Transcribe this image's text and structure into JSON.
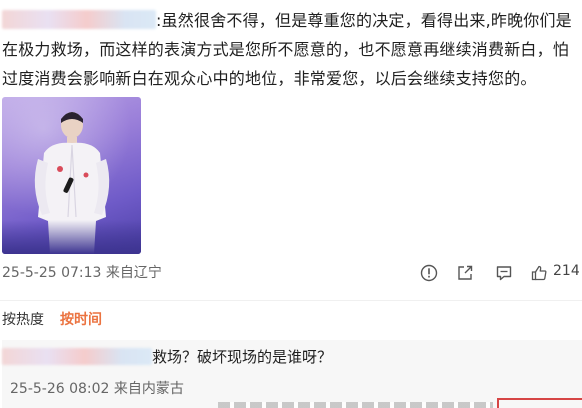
{
  "post": {
    "text": ":虽然很舍不得，但是尊重您的决定，看得出来,昨晚你们是在极力救场，而这样的表演方式是您所不愿意的，也不愿意再继续消费新白，怕过度消费会影响新白在观众心中的地位，非常爱您，以后会继续支持您的。",
    "meta": "25-5-25 07:13 来自辽宁",
    "like_count": "214"
  },
  "sort": {
    "hot_label": "按热度",
    "time_label": "按时间"
  },
  "reply": {
    "text": "救场？破坏现场的是谁呀？",
    "meta": "25-5-26 08:02 来自内蒙古"
  },
  "icons": {
    "report": "exclamation-circle-icon",
    "share": "share-icon",
    "comment": "comment-icon",
    "like": "thumbs-up-icon"
  },
  "colors": {
    "accent": "#eb7340",
    "meta_text": "#666666",
    "reply_bg": "#f7f7f7"
  }
}
